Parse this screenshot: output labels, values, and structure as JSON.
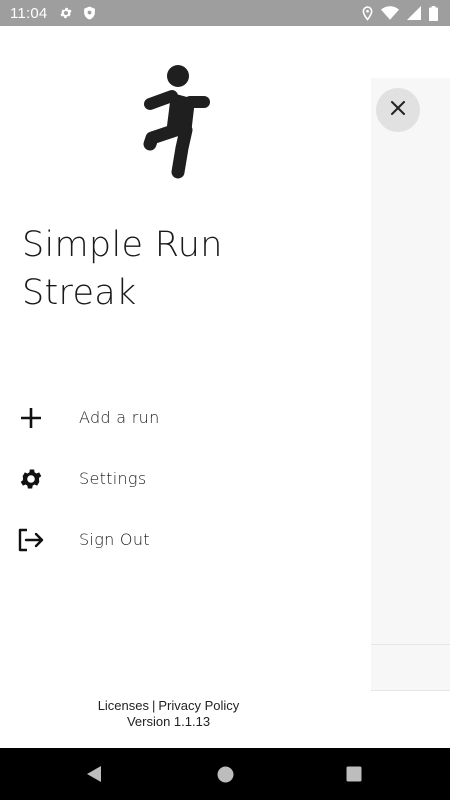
{
  "status_bar": {
    "time": "11:04",
    "left_icons": [
      "settings-gear-icon",
      "shield-icon"
    ],
    "right_icons": [
      "location-icon",
      "wifi-icon",
      "cellular-signal-icon",
      "battery-icon"
    ]
  },
  "drawer": {
    "logo_icon": "running-person-icon",
    "title_line1": "Simple Run",
    "title_line2": "Streak",
    "menu": [
      {
        "label": "Add a run",
        "icon": "plus-icon"
      },
      {
        "label": "Settings",
        "icon": "gear-icon"
      },
      {
        "label": "Sign Out",
        "icon": "sign-out-icon"
      }
    ],
    "footer": {
      "licenses": "Licenses",
      "separator": "|",
      "privacy": "Privacy Policy",
      "version": "Version 1.1.13"
    }
  },
  "background": {
    "close_icon": "close-icon"
  },
  "nav_bar": {
    "buttons": [
      "back-icon",
      "home-icon",
      "recents-icon"
    ]
  }
}
